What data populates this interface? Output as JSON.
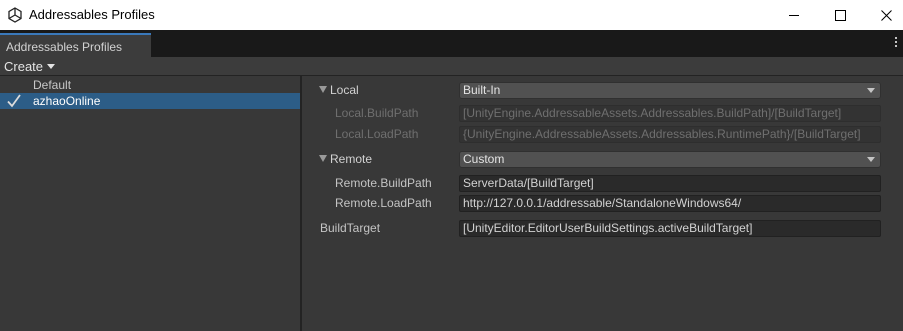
{
  "window": {
    "title": "Addressables Profiles",
    "icons": {
      "app": "unity-logo-icon",
      "minimize": "minimize-icon",
      "maximize": "maximize-icon",
      "close": "close-icon"
    }
  },
  "tab": {
    "label": "Addressables Profiles",
    "menu_icon": "kebab-menu-icon"
  },
  "toolbar": {
    "create_label": "Create"
  },
  "profiles": {
    "items": [
      {
        "label": "Default",
        "selected": false
      },
      {
        "label": "azhaoOnline",
        "selected": true,
        "icon": "checkmark-icon"
      }
    ]
  },
  "inspector": {
    "local": {
      "label": "Local",
      "value": "Built-In",
      "build_path_label": "Local.BuildPath",
      "build_path_value": "[UnityEngine.AddressableAssets.Addressables.BuildPath]/[BuildTarget]",
      "load_path_label": "Local.LoadPath",
      "load_path_value": "{UnityEngine.AddressableAssets.Addressables.RuntimePath}/[BuildTarget]"
    },
    "remote": {
      "label": "Remote",
      "value": "Custom",
      "build_path_label": "Remote.BuildPath",
      "build_path_value": "ServerData/[BuildTarget]",
      "load_path_label": "Remote.LoadPath",
      "load_path_value": "http://127.0.0.1/addressable/StandaloneWindows64/"
    },
    "build_target": {
      "label": "BuildTarget",
      "value": "[UnityEditor.EditorUserBuildSettings.activeBuildTarget]"
    }
  },
  "colors": {
    "selection": "#2c5d87",
    "panel": "#383838",
    "tab_accent": "#3a79bb"
  }
}
